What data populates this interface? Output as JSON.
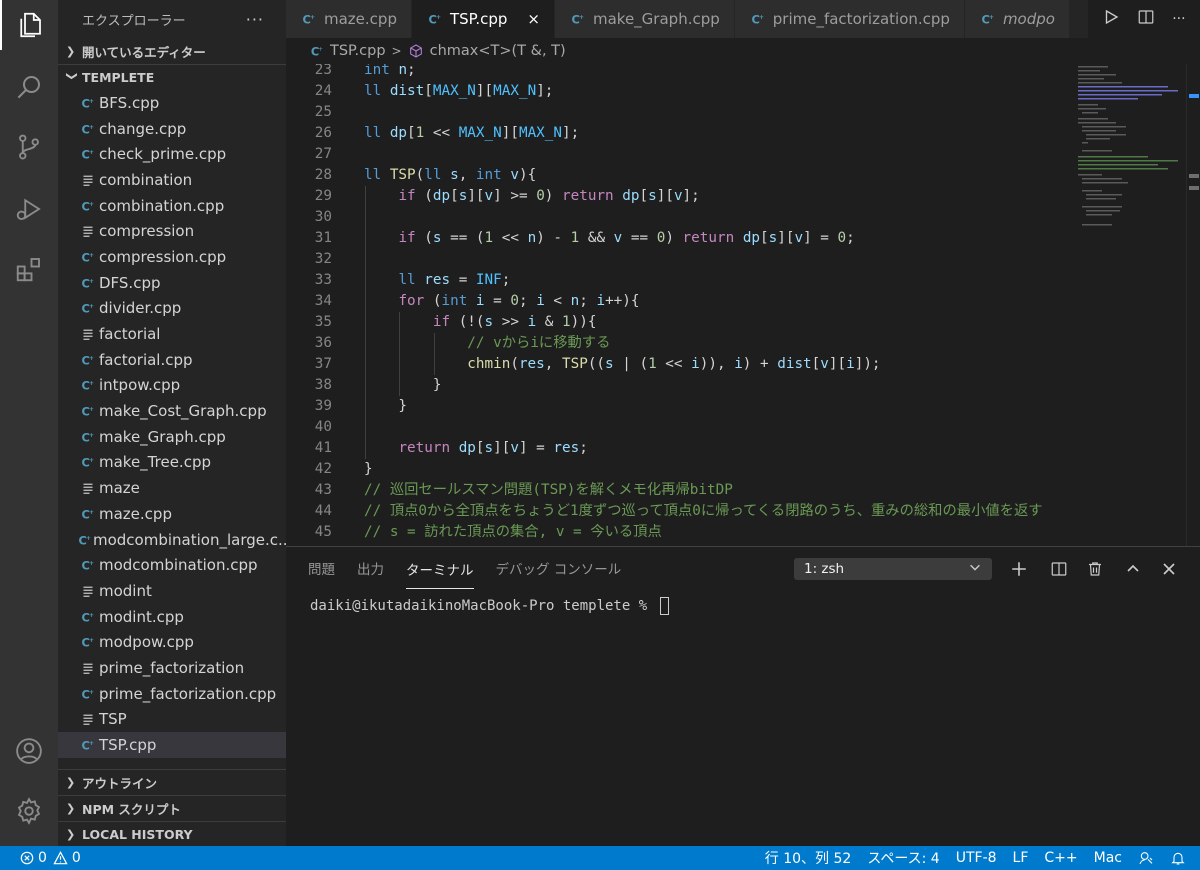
{
  "sidebar": {
    "title": "エクスプローラー",
    "more": "···",
    "open_editors": "開いているエディター",
    "folder": "TEMPLETE",
    "files": [
      {
        "name": "BFS.cpp",
        "kind": "cpp"
      },
      {
        "name": "change.cpp",
        "kind": "cpp"
      },
      {
        "name": "check_prime.cpp",
        "kind": "cpp"
      },
      {
        "name": "combination",
        "kind": "text"
      },
      {
        "name": "combination.cpp",
        "kind": "cpp"
      },
      {
        "name": "compression",
        "kind": "text"
      },
      {
        "name": "compression.cpp",
        "kind": "cpp"
      },
      {
        "name": "DFS.cpp",
        "kind": "cpp"
      },
      {
        "name": "divider.cpp",
        "kind": "cpp"
      },
      {
        "name": "factorial",
        "kind": "text"
      },
      {
        "name": "factorial.cpp",
        "kind": "cpp"
      },
      {
        "name": "intpow.cpp",
        "kind": "cpp"
      },
      {
        "name": "make_Cost_Graph.cpp",
        "kind": "cpp"
      },
      {
        "name": "make_Graph.cpp",
        "kind": "cpp"
      },
      {
        "name": "make_Tree.cpp",
        "kind": "cpp"
      },
      {
        "name": "maze",
        "kind": "text"
      },
      {
        "name": "maze.cpp",
        "kind": "cpp"
      },
      {
        "name": "modcombination_large.c...",
        "kind": "cpp"
      },
      {
        "name": "modcombination.cpp",
        "kind": "cpp"
      },
      {
        "name": "modint",
        "kind": "text"
      },
      {
        "name": "modint.cpp",
        "kind": "cpp"
      },
      {
        "name": "modpow.cpp",
        "kind": "cpp"
      },
      {
        "name": "prime_factorization",
        "kind": "text"
      },
      {
        "name": "prime_factorization.cpp",
        "kind": "cpp"
      },
      {
        "name": "TSP",
        "kind": "text"
      },
      {
        "name": "TSP.cpp",
        "kind": "cpp",
        "active": true
      }
    ],
    "outline": "アウトライン",
    "npm": "NPM スクリプト",
    "local_history": "LOCAL HISTORY"
  },
  "tabs": [
    {
      "label": "maze.cpp"
    },
    {
      "label": "TSP.cpp",
      "active": true,
      "close": "×"
    },
    {
      "label": "make_Graph.cpp"
    },
    {
      "label": "prime_factorization.cpp"
    },
    {
      "label": "modpo",
      "italic": true
    }
  ],
  "breadcrumb": {
    "file": "TSP.cpp",
    "sep": ">",
    "symbol": "chmax<T>(T &, T)"
  },
  "code": [
    {
      "n": "23",
      "text": "int n;"
    },
    {
      "n": "24",
      "text": "ll dist[MAX_N][MAX_N];"
    },
    {
      "n": "25",
      "text": ""
    },
    {
      "n": "26",
      "text": "ll dp[1 << MAX_N][MAX_N];"
    },
    {
      "n": "27",
      "text": ""
    },
    {
      "n": "28",
      "text": "ll TSP(ll s, int v){"
    },
    {
      "n": "29",
      "text": "    if (dp[s][v] >= 0) return dp[s][v];"
    },
    {
      "n": "30",
      "text": ""
    },
    {
      "n": "31",
      "text": "    if (s == (1 << n) - 1 && v == 0) return dp[s][v] = 0;"
    },
    {
      "n": "32",
      "text": ""
    },
    {
      "n": "33",
      "text": "    ll res = INF;"
    },
    {
      "n": "34",
      "text": "    for (int i = 0; i < n; i++){"
    },
    {
      "n": "35",
      "text": "        if (!(s >> i & 1)){"
    },
    {
      "n": "36",
      "text": "            // vからiに移動する"
    },
    {
      "n": "37",
      "text": "            chmin(res, TSP((s | (1 << i)), i) + dist[v][i]);"
    },
    {
      "n": "38",
      "text": "        }"
    },
    {
      "n": "39",
      "text": "    }"
    },
    {
      "n": "40",
      "text": ""
    },
    {
      "n": "41",
      "text": "    return dp[s][v] = res;"
    },
    {
      "n": "42",
      "text": "}"
    },
    {
      "n": "43",
      "text": "// 巡回セールスマン問題(TSP)を解くメモ化再帰bitDP"
    },
    {
      "n": "44",
      "text": "// 頂点0から全頂点をちょうど1度ずつ巡って頂点0に帰ってくる閉路のうち、重みの総和の最小値を返す"
    },
    {
      "n": "45",
      "text": "// s = 訪れた頂点の集合, v = 今いる頂点"
    }
  ],
  "panel": {
    "tabs": [
      "問題",
      "出力",
      "ターミナル",
      "デバッグ コンソール"
    ],
    "active_tab": 2,
    "terminal_select": "1: zsh",
    "prompt": "daiki@ikutadaikinoMacBook-Pro templete % "
  },
  "status": {
    "errors": "0",
    "warnings": "0",
    "position": "行 10、列 52",
    "spaces": "スペース: 4",
    "encoding": "UTF-8",
    "eol": "LF",
    "language": "C++",
    "os": "Mac"
  },
  "colors": {
    "status_bar": "#007acc",
    "activity_bar": "#333333",
    "sidebar": "#252526",
    "editor": "#1e1e1e",
    "cpp_icon": "#519aba"
  }
}
